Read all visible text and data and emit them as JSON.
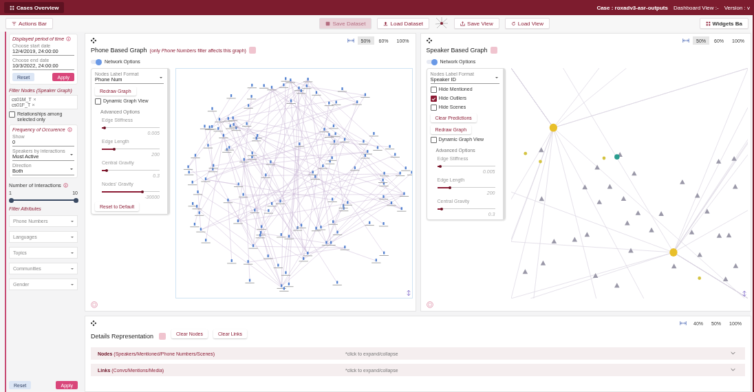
{
  "top_bar": {
    "menu_button": "Cases Overview",
    "case": "Case : roxadv3-asr-outputs",
    "dashboard_view": "Dashboard View :-",
    "version": "Version : v"
  },
  "toolbar": {
    "actions_button": "Actions Bar",
    "left_buttons": [
      {
        "label": "Save Dataset",
        "disabled": true
      },
      {
        "label": "Load Dataset",
        "disabled": false
      }
    ],
    "right_buttons": [
      {
        "label": "Save View",
        "disabled": false
      },
      {
        "label": "Load View",
        "disabled": false
      }
    ],
    "widgets_button": "Widgets Ba"
  },
  "sidebar": {
    "period": {
      "title": "Displayed period of time",
      "start_label": "Choose start date",
      "start_value": "12/4/2019, 24:00:00",
      "end_label": "Choose end date",
      "end_value": "10/3/2022, 24:00:00",
      "reset": "Reset",
      "apply": "Apply"
    },
    "filter_nodes": {
      "title": "Filter Nodes (Speaker Graph)",
      "chips": [
        "cs01M_T",
        "cs01F_T"
      ],
      "relationships_label": "Relationships among selected only",
      "relationships_checked": false
    },
    "frequency": {
      "title": "Frequency of Occurence",
      "fields": [
        {
          "label": "Show",
          "value": "0",
          "kind": "text"
        },
        {
          "label": "Speakers by interactions",
          "value": "Most Active",
          "kind": "select"
        },
        {
          "label": "Direction",
          "value": "Both",
          "kind": "select"
        }
      ]
    },
    "interactions": {
      "title": "Number of Interactions",
      "min": "1",
      "max": "10",
      "level": 1
    },
    "filter_attributes": {
      "title": "Filter Attributes",
      "dropdowns": [
        "Phone Numbers",
        "Languages",
        "Topics",
        "Communities",
        "Gender"
      ]
    },
    "reset": "Reset",
    "apply": "Apply"
  },
  "graphs": [
    {
      "kind": "phone",
      "title": "Phone Based Graph",
      "note": "(only *Phone Numbers* filter affects this graph)",
      "width_options": [
        {
          "label": "50%",
          "selected": true
        },
        {
          "label": "60%",
          "selected": false
        },
        {
          "label": "100%",
          "selected": false
        }
      ],
      "network_options": {
        "label": "Network Options",
        "on": true
      },
      "controls": [
        {
          "kind": "select",
          "label": "Nodes Label Format",
          "value": "Phone Num"
        },
        {
          "kind": "button",
          "label": "Redraw Graph"
        },
        {
          "kind": "checkbox",
          "label": "Dynamic Graph View",
          "checked": false
        },
        {
          "kind": "heading",
          "label": "Advanced Options"
        },
        {
          "kind": "slider",
          "label": "Edge Stiffness",
          "value": "0.005",
          "level": 0.05
        },
        {
          "kind": "slider",
          "label": "Edge Length",
          "value": "200",
          "level": 0.22
        },
        {
          "kind": "slider",
          "label": "Central Gravity",
          "value": "0.3",
          "level": 0.08
        },
        {
          "kind": "slider",
          "label": "Nodes' Gravity",
          "value": "-30000",
          "level": 0.7
        },
        {
          "kind": "button",
          "label": "Reset to Default"
        }
      ]
    },
    {
      "kind": "speaker",
      "title": "Speaker Based Graph",
      "width_options": [
        {
          "label": "50%",
          "selected": true
        },
        {
          "label": "60%",
          "selected": false
        },
        {
          "label": "100%",
          "selected": false
        }
      ],
      "network_options": {
        "label": "Network Options",
        "on": true
      },
      "controls": [
        {
          "kind": "select",
          "label": "Nodes Label Format",
          "value": "Speaker ID"
        },
        {
          "kind": "checkbox",
          "label": "Hide Mentioned",
          "checked": false
        },
        {
          "kind": "checkbox",
          "label": "Hide Outliers",
          "checked": true
        },
        {
          "kind": "checkbox",
          "label": "Hide Scenes",
          "checked": false
        },
        {
          "kind": "button",
          "label": "Clear Predictions"
        },
        {
          "kind": "button",
          "label": "Redraw Graph"
        },
        {
          "kind": "checkbox",
          "label": "Dynamic Graph View",
          "checked": false
        },
        {
          "kind": "heading",
          "label": "Advanced Options"
        },
        {
          "kind": "slider",
          "label": "Edge Stiffness",
          "value": "0.005",
          "level": 0.05
        },
        {
          "kind": "slider",
          "label": "Edge Length",
          "value": "200",
          "level": 0.22
        },
        {
          "kind": "slider",
          "label": "Central Gravity",
          "value": "0.3",
          "level": 0.08
        }
      ]
    }
  ],
  "details": {
    "title": "Details Representation",
    "buttons": [
      "Clear Nodes",
      "Clear Links"
    ],
    "width_options": [
      {
        "label": "40%",
        "selected": false
      },
      {
        "label": "50%",
        "selected": false
      },
      {
        "label": "100%",
        "selected": false
      }
    ],
    "sections": [
      {
        "title": "Nodes",
        "subtitle": "(Speakers/Mentioned/Phone Numbers/Scenes)",
        "hint": "*click to expand/collapse",
        "expanded": false
      },
      {
        "title": "Links",
        "subtitle": "(Convs/Mentions/Media)",
        "hint": "*click to expand/collapse",
        "expanded": false
      }
    ]
  }
}
